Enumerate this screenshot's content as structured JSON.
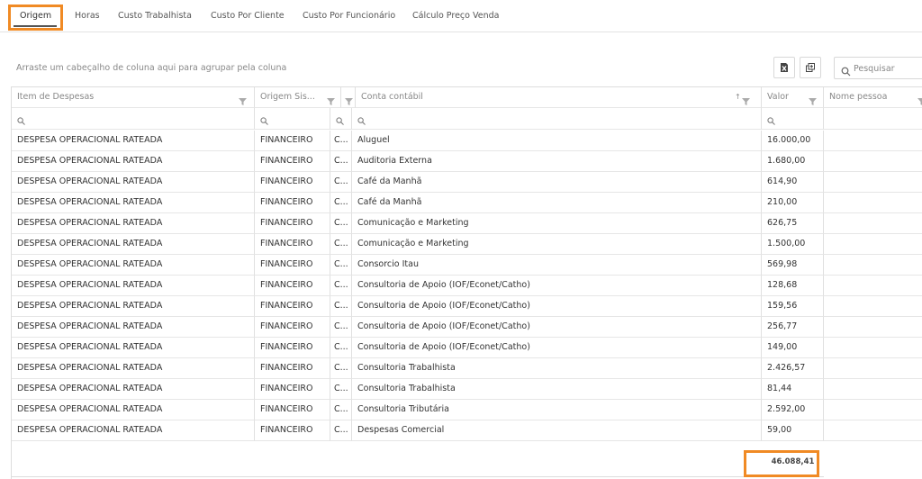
{
  "tabs": [
    {
      "label": "Origem",
      "active": true
    },
    {
      "label": "Horas",
      "active": false
    },
    {
      "label": "Custo Trabalhista",
      "active": false
    },
    {
      "label": "Custo Por Cliente",
      "active": false
    },
    {
      "label": "Custo Por Funcionário",
      "active": false
    },
    {
      "label": "Cálculo Preço Venda",
      "active": false
    }
  ],
  "toolbar": {
    "group_hint": "Arraste um cabeçalho de coluna aqui para agrupar pela coluna",
    "export_excel_icon": "excel-export-icon",
    "column_chooser_icon": "column-chooser-icon",
    "search_placeholder": "Pesquisar"
  },
  "grid": {
    "columns": [
      {
        "label": "Item de Despesas"
      },
      {
        "label": "Origem Sis..."
      },
      {
        "label": ""
      },
      {
        "label": "Conta contábil",
        "sort": "ascending"
      },
      {
        "label": "Valor"
      },
      {
        "label": "Nome pessoa"
      }
    ],
    "rows": [
      {
        "item": "DESPESA OPERACIONAL RATEADA",
        "origem": "FINANCEIRO",
        "col3": "C...",
        "conta": "Aluguel",
        "valor": "16.000,00",
        "pessoa": ""
      },
      {
        "item": "DESPESA OPERACIONAL RATEADA",
        "origem": "FINANCEIRO",
        "col3": "C...",
        "conta": "Auditoria Externa",
        "valor": "1.680,00",
        "pessoa": ""
      },
      {
        "item": "DESPESA OPERACIONAL RATEADA",
        "origem": "FINANCEIRO",
        "col3": "C...",
        "conta": "Café da Manhã",
        "valor": "614,90",
        "pessoa": ""
      },
      {
        "item": "DESPESA OPERACIONAL RATEADA",
        "origem": "FINANCEIRO",
        "col3": "C...",
        "conta": "Café da Manhã",
        "valor": "210,00",
        "pessoa": ""
      },
      {
        "item": "DESPESA OPERACIONAL RATEADA",
        "origem": "FINANCEIRO",
        "col3": "C...",
        "conta": "Comunicação e Marketing",
        "valor": "626,75",
        "pessoa": ""
      },
      {
        "item": "DESPESA OPERACIONAL RATEADA",
        "origem": "FINANCEIRO",
        "col3": "C...",
        "conta": "Comunicação e Marketing",
        "valor": "1.500,00",
        "pessoa": ""
      },
      {
        "item": "DESPESA OPERACIONAL RATEADA",
        "origem": "FINANCEIRO",
        "col3": "C...",
        "conta": "Consorcio Itau",
        "valor": "569,98",
        "pessoa": ""
      },
      {
        "item": "DESPESA OPERACIONAL RATEADA",
        "origem": "FINANCEIRO",
        "col3": "C...",
        "conta": "Consultoria de Apoio (IOF/Econet/Catho)",
        "valor": "128,68",
        "pessoa": ""
      },
      {
        "item": "DESPESA OPERACIONAL RATEADA",
        "origem": "FINANCEIRO",
        "col3": "C...",
        "conta": "Consultoria de Apoio (IOF/Econet/Catho)",
        "valor": "159,56",
        "pessoa": ""
      },
      {
        "item": "DESPESA OPERACIONAL RATEADA",
        "origem": "FINANCEIRO",
        "col3": "C...",
        "conta": "Consultoria de Apoio (IOF/Econet/Catho)",
        "valor": "256,77",
        "pessoa": ""
      },
      {
        "item": "DESPESA OPERACIONAL RATEADA",
        "origem": "FINANCEIRO",
        "col3": "C...",
        "conta": "Consultoria de Apoio (IOF/Econet/Catho)",
        "valor": "149,00",
        "pessoa": ""
      },
      {
        "item": "DESPESA OPERACIONAL RATEADA",
        "origem": "FINANCEIRO",
        "col3": "C...",
        "conta": "Consultoria Trabalhista",
        "valor": "2.426,57",
        "pessoa": ""
      },
      {
        "item": "DESPESA OPERACIONAL RATEADA",
        "origem": "FINANCEIRO",
        "col3": "C...",
        "conta": "Consultoria Trabalhista",
        "valor": "81,44",
        "pessoa": ""
      },
      {
        "item": "DESPESA OPERACIONAL RATEADA",
        "origem": "FINANCEIRO",
        "col3": "C...",
        "conta": "Consultoria Tributária",
        "valor": "2.592,00",
        "pessoa": ""
      },
      {
        "item": "DESPESA OPERACIONAL RATEADA",
        "origem": "FINANCEIRO",
        "col3": "C...",
        "conta": "Despesas Comercial",
        "valor": "59,00",
        "pessoa": ""
      }
    ],
    "total": "46.088,41"
  },
  "colors": {
    "highlight": "#f08a24",
    "grid_line": "#e0e0e0",
    "header_text": "#888888"
  }
}
